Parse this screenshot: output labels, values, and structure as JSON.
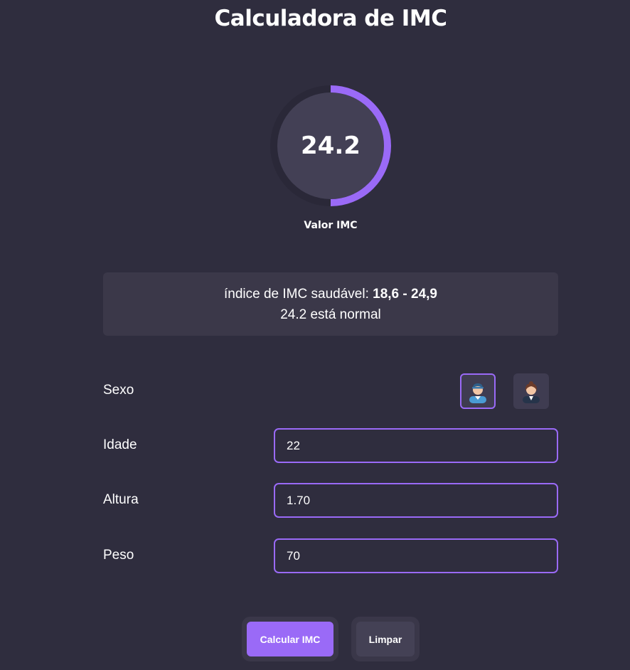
{
  "header": {
    "title": "Calculadora de IMC"
  },
  "gauge": {
    "value": "24.2",
    "label": "Valor IMC",
    "fill_fraction": 0.5,
    "accent": "#9a6af7"
  },
  "info": {
    "healthy_prefix": "índice de IMC saudável: ",
    "healthy_range": "18,6 - 24,9",
    "status": "24.2 está normal"
  },
  "form": {
    "sex": {
      "label": "Sexo",
      "options": [
        {
          "icon": "male-avatar-icon",
          "selected": true
        },
        {
          "icon": "female-avatar-icon",
          "selected": false
        }
      ]
    },
    "age": {
      "label": "Idade",
      "value": "22"
    },
    "height": {
      "label": "Altura",
      "value": "1.70"
    },
    "weight": {
      "label": "Peso",
      "value": "70"
    }
  },
  "actions": {
    "calculate_label": "Calcular IMC",
    "clear_label": "Limpar"
  },
  "colors": {
    "background": "#2f2d3e",
    "accent": "#9a6af7",
    "panel": "#3b3849"
  }
}
